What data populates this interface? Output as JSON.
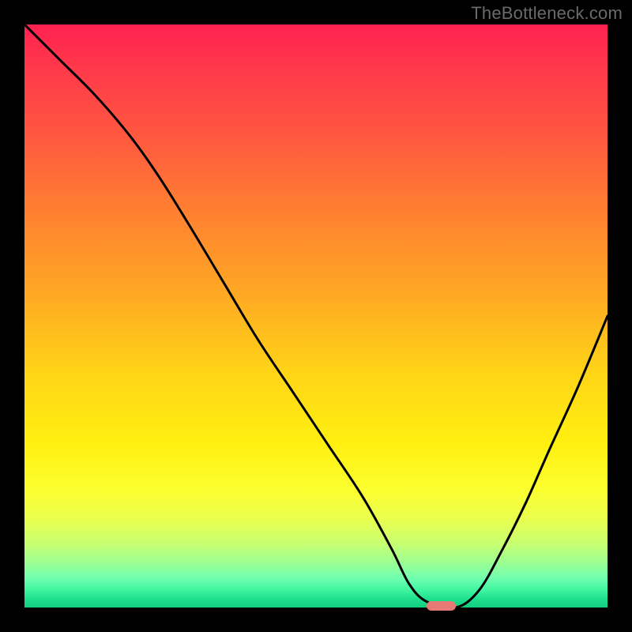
{
  "watermark": {
    "text": "TheBottleneck.com"
  },
  "chart_data": {
    "type": "line",
    "title": "",
    "xlabel": "",
    "ylabel": "",
    "xlim": [
      0,
      100
    ],
    "ylim": [
      0,
      100
    ],
    "series": [
      {
        "name": "bottleneck-curve",
        "x": [
          0,
          6,
          12,
          18,
          23,
          28,
          34,
          40,
          46,
          52,
          58,
          63,
          66,
          69,
          74,
          78,
          82,
          86,
          90,
          95,
          100
        ],
        "values": [
          100,
          94,
          88,
          81,
          74,
          66,
          56,
          46,
          37,
          28,
          19,
          10,
          4,
          1,
          0,
          3,
          10,
          18,
          27,
          38,
          50
        ]
      }
    ],
    "marker": {
      "x": 71.5,
      "y": 0.3,
      "width_pct": 5.0,
      "height_pct": 1.6
    },
    "gradient_stops": [
      {
        "pct": 0,
        "color": "#ff2250"
      },
      {
        "pct": 8,
        "color": "#ff3a4a"
      },
      {
        "pct": 20,
        "color": "#ff5a3e"
      },
      {
        "pct": 30,
        "color": "#ff7a33"
      },
      {
        "pct": 45,
        "color": "#ffa524"
      },
      {
        "pct": 60,
        "color": "#ffd516"
      },
      {
        "pct": 72,
        "color": "#fff010"
      },
      {
        "pct": 80,
        "color": "#fbff30"
      },
      {
        "pct": 85,
        "color": "#e8ff50"
      },
      {
        "pct": 89,
        "color": "#c8ff70"
      },
      {
        "pct": 92,
        "color": "#a0ff90"
      },
      {
        "pct": 95,
        "color": "#70ffb0"
      },
      {
        "pct": 97,
        "color": "#40f5a0"
      },
      {
        "pct": 98.5,
        "color": "#20e090"
      },
      {
        "pct": 100,
        "color": "#10d080"
      }
    ]
  }
}
